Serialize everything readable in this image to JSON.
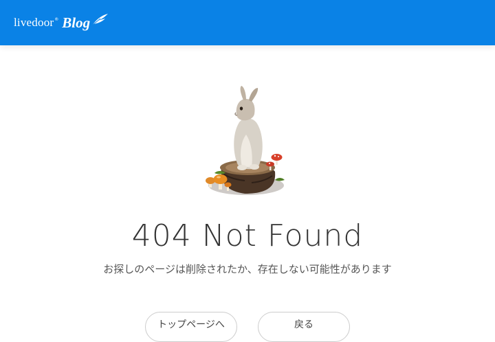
{
  "header": {
    "logo_livedoor": "livedoor",
    "logo_mark": "®",
    "logo_blog": "Blog",
    "background": "#0a82e6"
  },
  "main": {
    "illustration": "rabbit-on-tree-stump-with-mushrooms",
    "title": "404 Not Found",
    "message": "お探しのページは削除されたか、存在しない可能性があります"
  },
  "buttons": [
    {
      "label": "トップページへ"
    },
    {
      "label": "戻る"
    }
  ]
}
